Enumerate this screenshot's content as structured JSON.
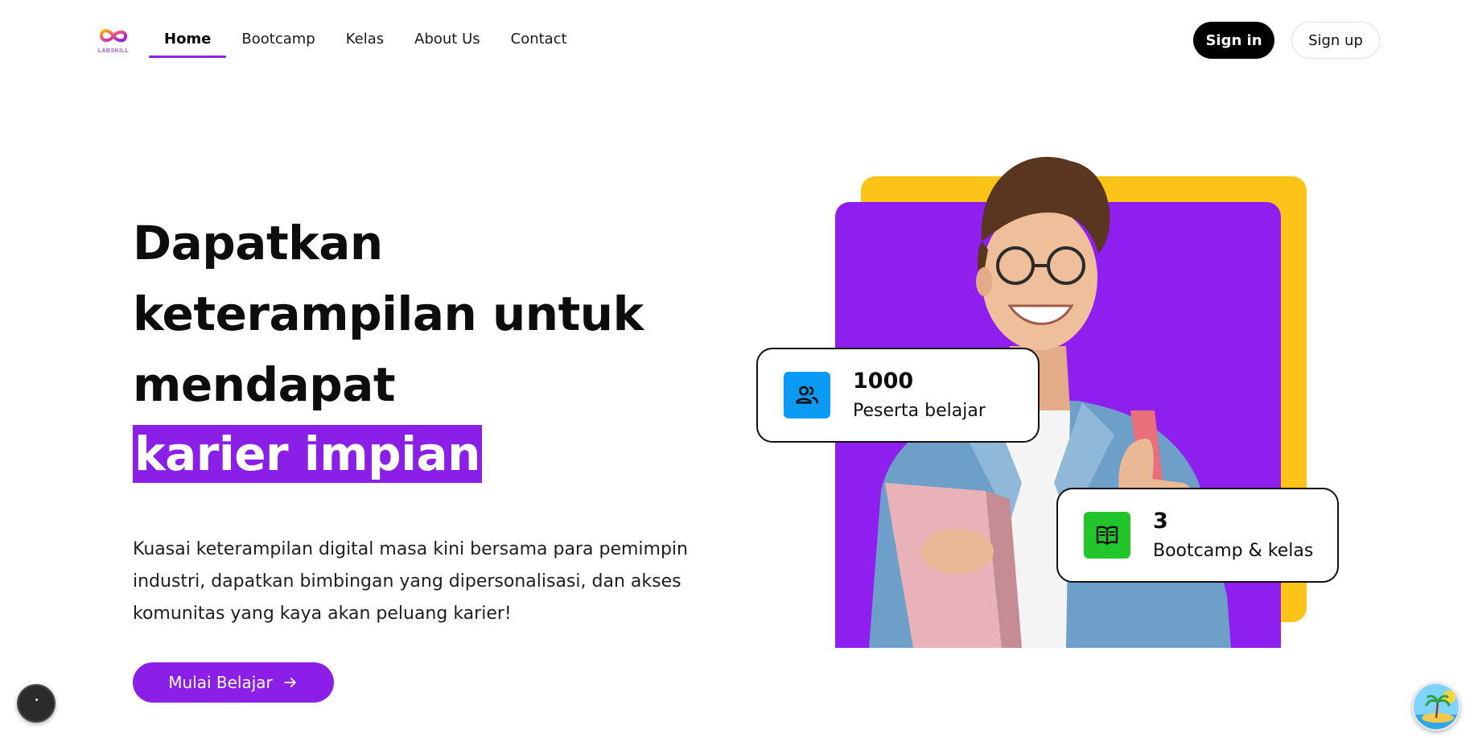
{
  "brand": {
    "logo_text": "LABSKILL"
  },
  "nav": {
    "items": [
      {
        "label": "Home",
        "active": true
      },
      {
        "label": "Bootcamp",
        "active": false
      },
      {
        "label": "Kelas",
        "active": false
      },
      {
        "label": "About Us",
        "active": false
      },
      {
        "label": "Contact",
        "active": false
      }
    ]
  },
  "auth": {
    "signin_label": "Sign in",
    "signup_label": "Sign up"
  },
  "hero": {
    "title_lines": [
      "Dapatkan",
      "keterampilan untuk",
      "mendapat"
    ],
    "title_highlight": "karier impian",
    "description": "Kuasai keterampilan digital masa kini bersama para pemimpin industri, dapatkan bimbingan yang dipersonalisasi, dan akses komunitas yang kaya akan peluang karier!",
    "cta_label": "Mulai Belajar",
    "cta_icon": "arrow-right-icon"
  },
  "stats": [
    {
      "value": "1000",
      "label": "Peserta belajar",
      "icon": "users-icon",
      "color": "#0b9bf5"
    },
    {
      "value": "3",
      "label": "Bootcamp & kelas",
      "icon": "book-icon",
      "color": "#22c52c"
    }
  ],
  "colors": {
    "accent": "#8b1fe8",
    "hero_card_purple": "#8f1fee",
    "hero_card_yellow": "#fcc419",
    "button_dark": "#000000"
  },
  "widgets": {
    "left": "chat-widget-icon",
    "right": "island-avatar-icon"
  }
}
